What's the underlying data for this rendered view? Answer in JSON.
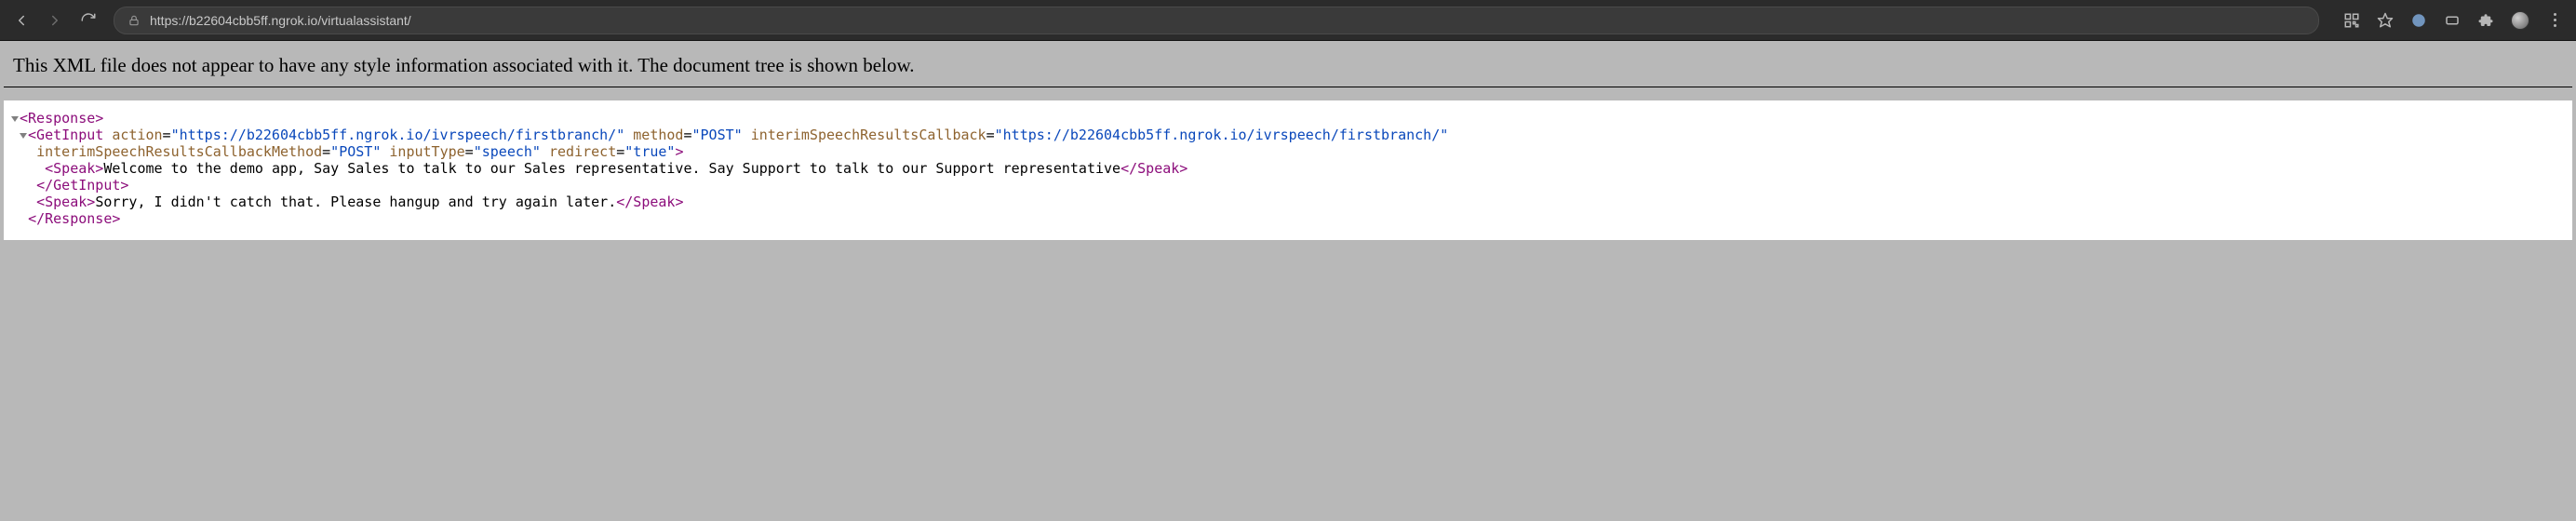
{
  "browser": {
    "url": "https://b22604cbb5ff.ngrok.io/virtualassistant/"
  },
  "notice": "This XML file does not appear to have any style information associated with it. The document tree is shown below.",
  "xml": {
    "rootOpen": "<Response>",
    "rootClose": "</Response>",
    "getInputClose": "</GetInput>",
    "attrs": {
      "actionName": "action",
      "actionVal": "\"https://b22604cbb5ff.ngrok.io/ivrspeech/firstbranch/\"",
      "methodName": "method",
      "methodVal": "\"POST\"",
      "cbName": "interimSpeechResultsCallback",
      "cbVal": "\"https://b22604cbb5ff.ngrok.io/ivrspeech/firstbranch/\"",
      "cbMethodName": "interimSpeechResultsCallbackMethod",
      "cbMethodVal": "\"POST\"",
      "inputTypeName": "inputType",
      "inputTypeVal": "\"speech\"",
      "redirectName": "redirect",
      "redirectVal": "\"true\""
    },
    "getInputOpenHead": "<GetInput",
    "speakOpen": "<Speak>",
    "speakClose": "</Speak>",
    "speak1": "Welcome to the demo app, Say Sales to talk to our Sales representative. Say Support to talk to our Support representative",
    "speak2": "Sorry, I didn't catch that. Please hangup and try again later."
  }
}
